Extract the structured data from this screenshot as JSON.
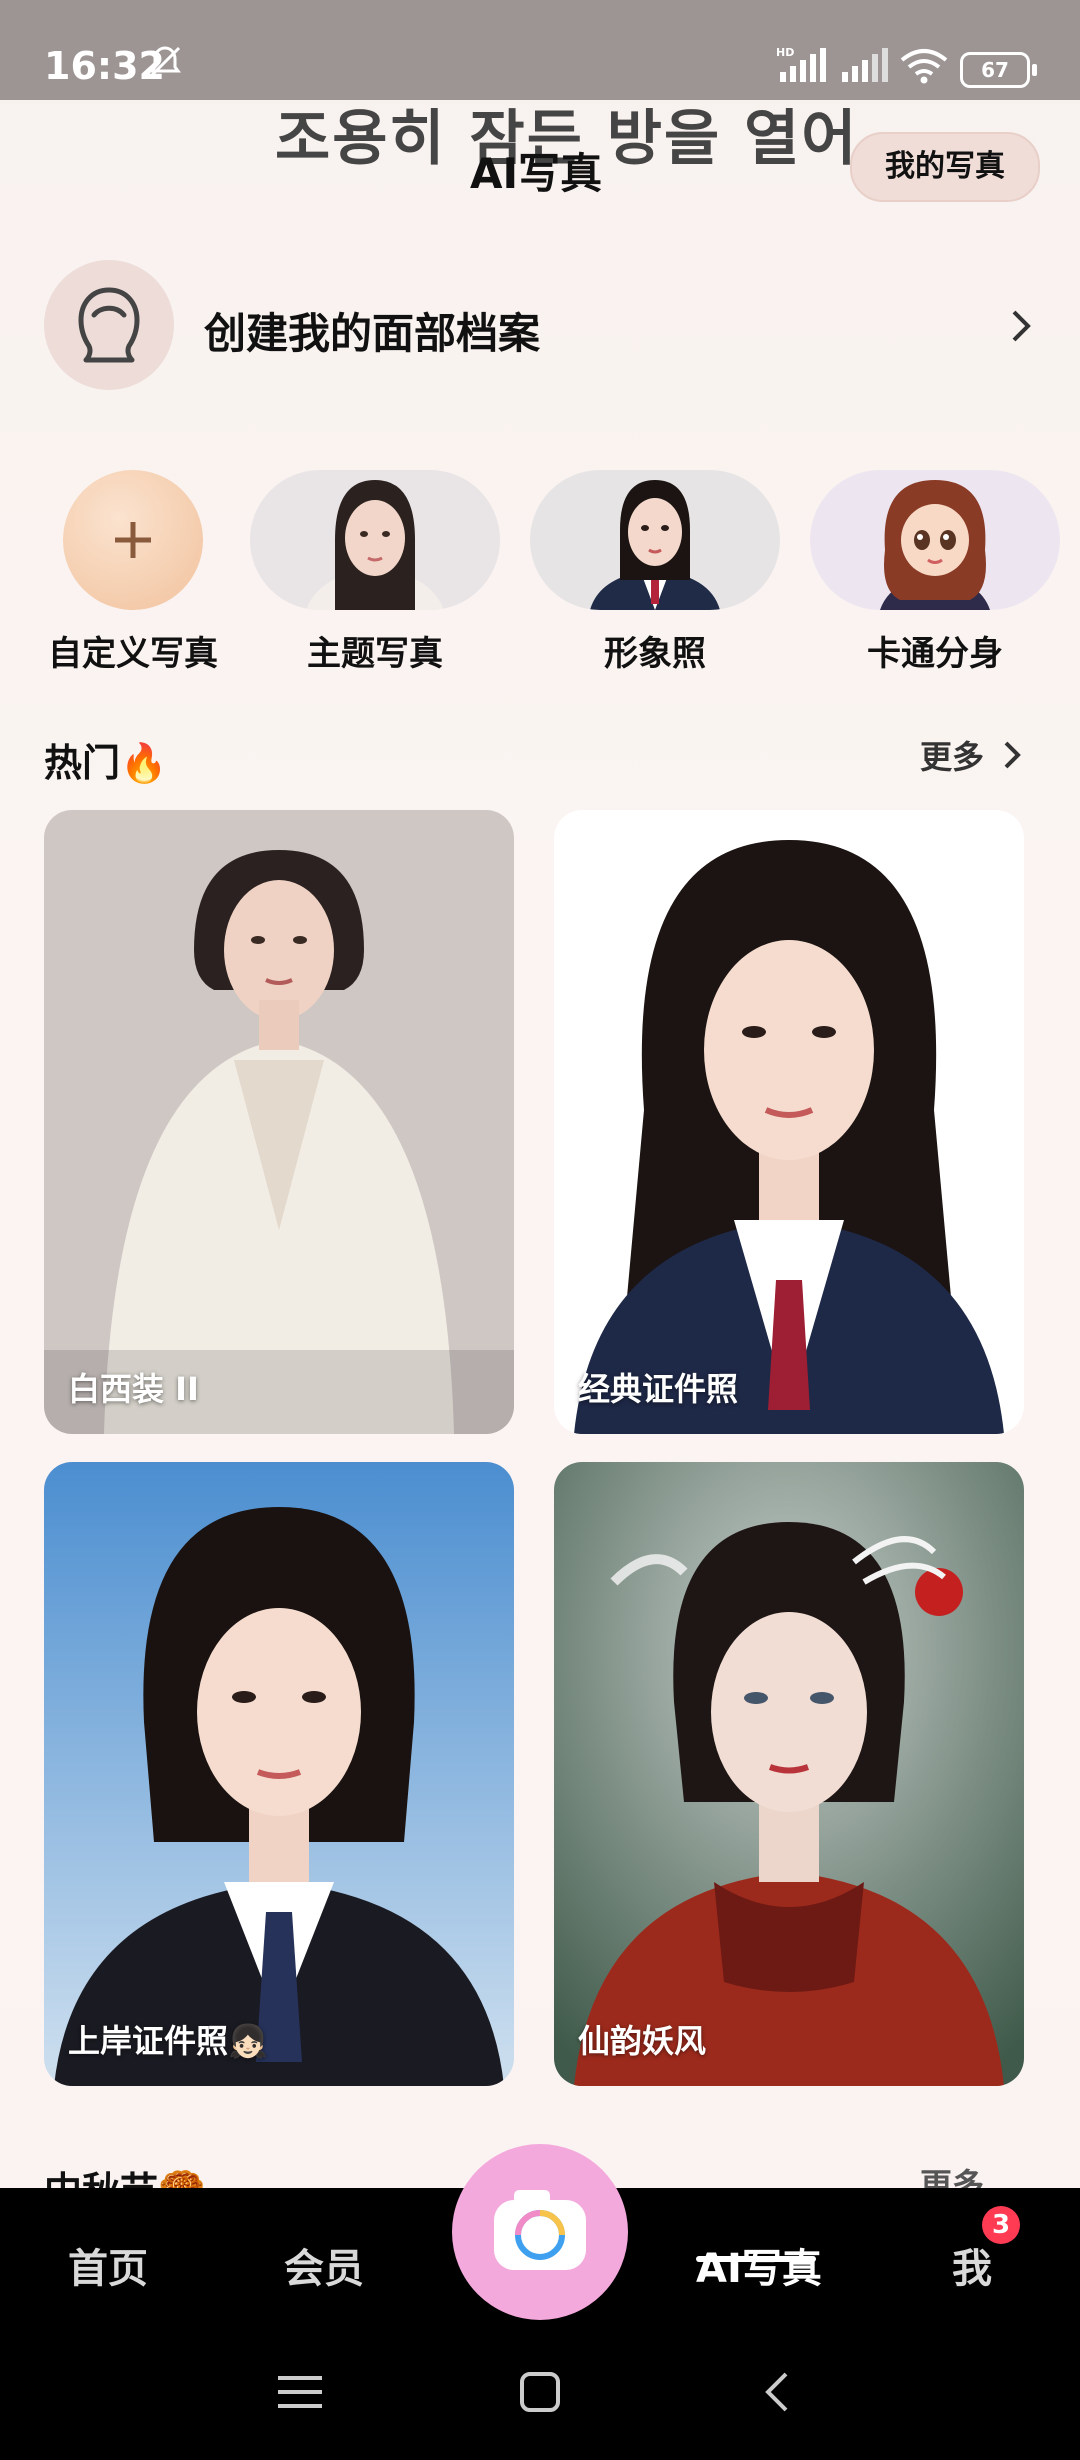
{
  "status_bar": {
    "time": "16:32",
    "network": "HD",
    "battery": "67"
  },
  "header": {
    "overlay_text": "조용히 잠든 방을 열어",
    "title": "AI写真",
    "my_photos_button": "我的写真"
  },
  "face_profile": {
    "label": "创建我的面部档案"
  },
  "categories": [
    {
      "label": "自定义写真"
    },
    {
      "label": "主题写真"
    },
    {
      "label": "形象照"
    },
    {
      "label": "卡通分身"
    }
  ],
  "hot_section": {
    "title": "热门🔥",
    "more": "更多"
  },
  "cards": [
    {
      "caption": "白西装 II"
    },
    {
      "caption": "经典证件照"
    },
    {
      "caption": "上岸证件照👧🏻"
    },
    {
      "caption": "仙韵妖风"
    }
  ],
  "next_section": {
    "title": "中秋节🥮",
    "more": "更多"
  },
  "bottom_nav": {
    "items": [
      "首页",
      "会员",
      "AI写真",
      "我"
    ],
    "active": "AI写真",
    "badge_count": "3"
  },
  "colors": {
    "accent_pink": "#f4a9dd",
    "badge_red": "#ff3b54",
    "nav_bg": "#000000"
  }
}
